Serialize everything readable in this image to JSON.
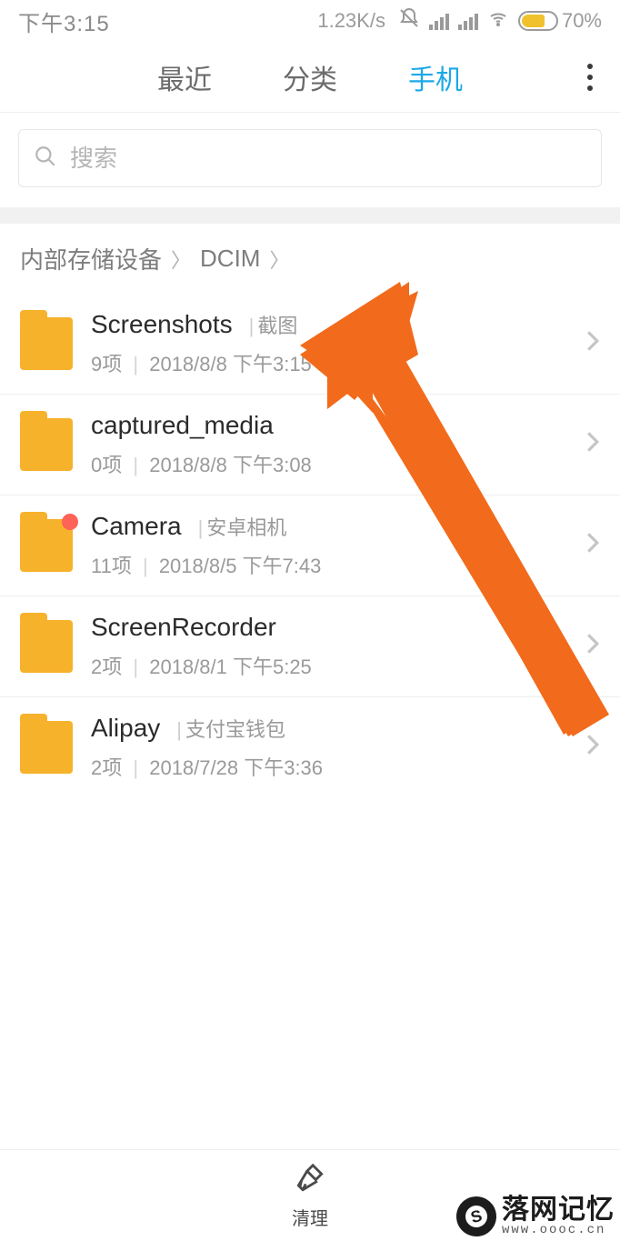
{
  "status": {
    "time": "下午3:15",
    "speed": "1.23K/s",
    "battery": "70%"
  },
  "tabs": {
    "recent": "最近",
    "category": "分类",
    "phone": "手机"
  },
  "search": {
    "placeholder": "搜索"
  },
  "breadcrumb": {
    "root": "内部存储设备",
    "dcim": "DCIM"
  },
  "folders": [
    {
      "name": "Screenshots",
      "sub": "截图",
      "count": "9项",
      "date": "2018/8/8 下午3:15",
      "favorite": false
    },
    {
      "name": "captured_media",
      "sub": "",
      "count": "0项",
      "date": "2018/8/8 下午3:08",
      "favorite": false
    },
    {
      "name": "Camera",
      "sub": "安卓相机",
      "count": "11项",
      "date": "2018/8/5 下午7:43",
      "favorite": true
    },
    {
      "name": "ScreenRecorder",
      "sub": "",
      "count": "2项",
      "date": "2018/8/1 下午5:25",
      "favorite": false
    },
    {
      "name": "Alipay",
      "sub": "支付宝钱包",
      "count": "2项",
      "date": "2018/7/28 下午3:36",
      "favorite": false
    }
  ],
  "bottom": {
    "clean": "清理"
  },
  "watermark": {
    "line1": "落网记忆",
    "line2": "www.oooc.cn"
  }
}
